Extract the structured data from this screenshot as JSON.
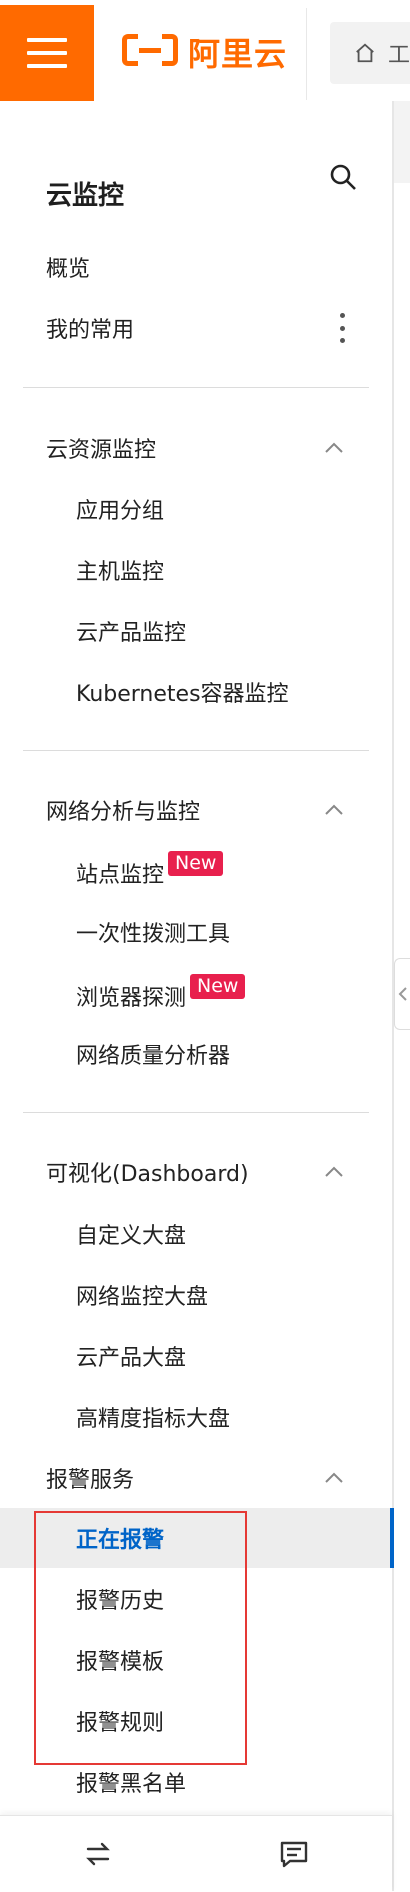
{
  "header": {
    "logo_text": "阿里云",
    "search_partial": "工"
  },
  "sidebar": {
    "title": "云监控",
    "top_items": [
      {
        "label": "概览"
      },
      {
        "label": "我的常用"
      }
    ],
    "groups": [
      {
        "label": "云资源监控",
        "items": [
          {
            "label": "应用分组"
          },
          {
            "label": "主机监控"
          },
          {
            "label": "云产品监控"
          },
          {
            "label": "Kubernetes容器监控"
          }
        ]
      },
      {
        "label": "网络分析与监控",
        "items": [
          {
            "label": "站点监控",
            "badge": "New"
          },
          {
            "label": "一次性拨测工具"
          },
          {
            "label": "浏览器探测",
            "badge": "New"
          },
          {
            "label": "网络质量分析器"
          }
        ]
      },
      {
        "label": "可视化(Dashboard)",
        "items": [
          {
            "label": "自定义大盘"
          },
          {
            "label": "网络监控大盘"
          },
          {
            "label": "云产品大盘"
          },
          {
            "label": "高精度指标大盘"
          }
        ]
      },
      {
        "label": "报警服务",
        "items": [
          {
            "label": "正在报警",
            "active": true
          },
          {
            "label": "报警历史"
          },
          {
            "label": "报警模板"
          },
          {
            "label": "报警规则"
          },
          {
            "label": "报警黑名单"
          }
        ]
      }
    ]
  },
  "icons": {
    "menu": "hamburger-icon",
    "search": "search-icon",
    "home": "home-icon",
    "more": "vertical-dots-icon",
    "chevron": "chevron-up-icon",
    "swap": "swap-icon",
    "feedback": "message-icon"
  },
  "colors": {
    "brand": "#ff6a00",
    "active": "#0064c8",
    "badge": "#e8204d",
    "highlight_box": "#e53935"
  }
}
